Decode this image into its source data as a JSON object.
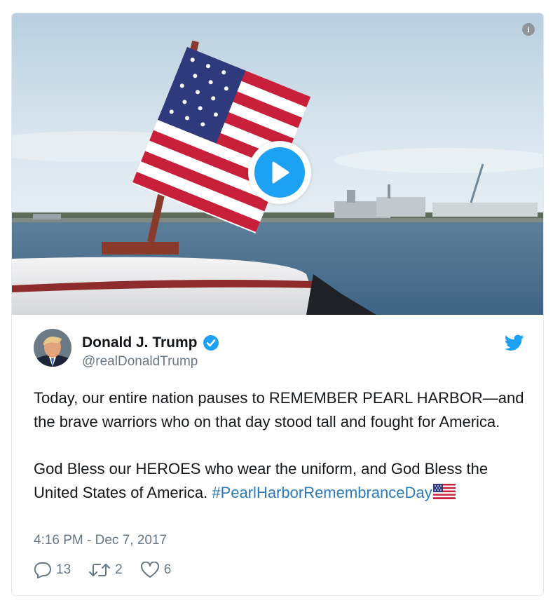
{
  "media": {
    "type": "video",
    "icons": {
      "info": "info-icon",
      "play": "play-icon"
    },
    "info_glyph": "i"
  },
  "author": {
    "display_name": "Donald J. Trump",
    "handle": "@realDonaldTrump",
    "verified": true,
    "icons": {
      "verified": "verified-badge-icon",
      "platform": "twitter-bird-icon"
    }
  },
  "tweet": {
    "paragraph_1": "Today, our entire nation pauses to REMEMBER PEARL HARBOR—and the brave warriors who on that day stood tall and fought for America.",
    "paragraph_2": "God Bless our HEROES who wear the uniform, and God Bless the United States of America. ",
    "hashtag": "#PearlHarborRemembranceDay",
    "emoji": "us-flag-emoji"
  },
  "timestamp": "4:16 PM - Dec 7, 2017",
  "actions": {
    "replies": "13",
    "retweets": "2",
    "likes": "6"
  },
  "colors": {
    "accent": "#1da1f2",
    "hashtag": "#2b7bb9",
    "secondary_text": "#657786",
    "border": "#e1e8ed"
  }
}
